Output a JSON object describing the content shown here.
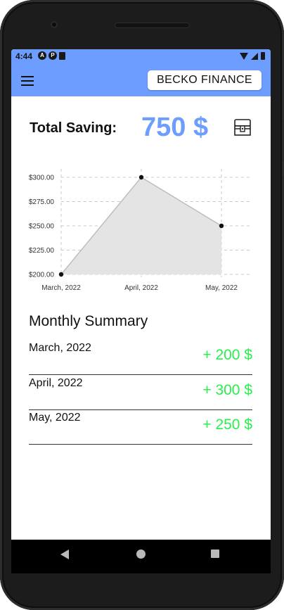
{
  "status_bar": {
    "time": "4:44",
    "left_icons": [
      "a-circle-icon",
      "p-circle-icon",
      "sim-icon"
    ],
    "right_icons": [
      "wifi-icon",
      "signal-icon",
      "battery-icon"
    ]
  },
  "app_bar": {
    "menu_icon": "hamburger-menu-icon",
    "brand": "BECKO FINANCE"
  },
  "total": {
    "label": "Total Saving:",
    "value": "750 $",
    "icon": "treasure-chest-icon"
  },
  "chart_data": {
    "type": "area",
    "categories": [
      "March, 2022",
      "April, 2022",
      "May, 2022"
    ],
    "values": [
      200,
      300,
      250
    ],
    "y_ticks": [
      "$200.00",
      "$225.00",
      "$250.00",
      "$275.00",
      "$300.00"
    ],
    "ylim": [
      200,
      300
    ],
    "grid": true,
    "grid_style": "dashed",
    "fill_color": "#e4e4e4",
    "line_color": "#bdbdbd",
    "point_color": "#111111"
  },
  "summary": {
    "title": "Monthly Summary",
    "rows": [
      {
        "month": "March, 2022",
        "amount": "+ 200 $"
      },
      {
        "month": "April, 2022",
        "amount": "+ 300 $"
      },
      {
        "month": "May, 2022",
        "amount": "+ 250 $"
      }
    ]
  },
  "colors": {
    "accent": "#6d9eff",
    "positive": "#27f04d",
    "frame": "#1c1c1c"
  },
  "nav_bar": {
    "icons": [
      "back-icon",
      "home-icon",
      "recent-apps-icon"
    ]
  }
}
